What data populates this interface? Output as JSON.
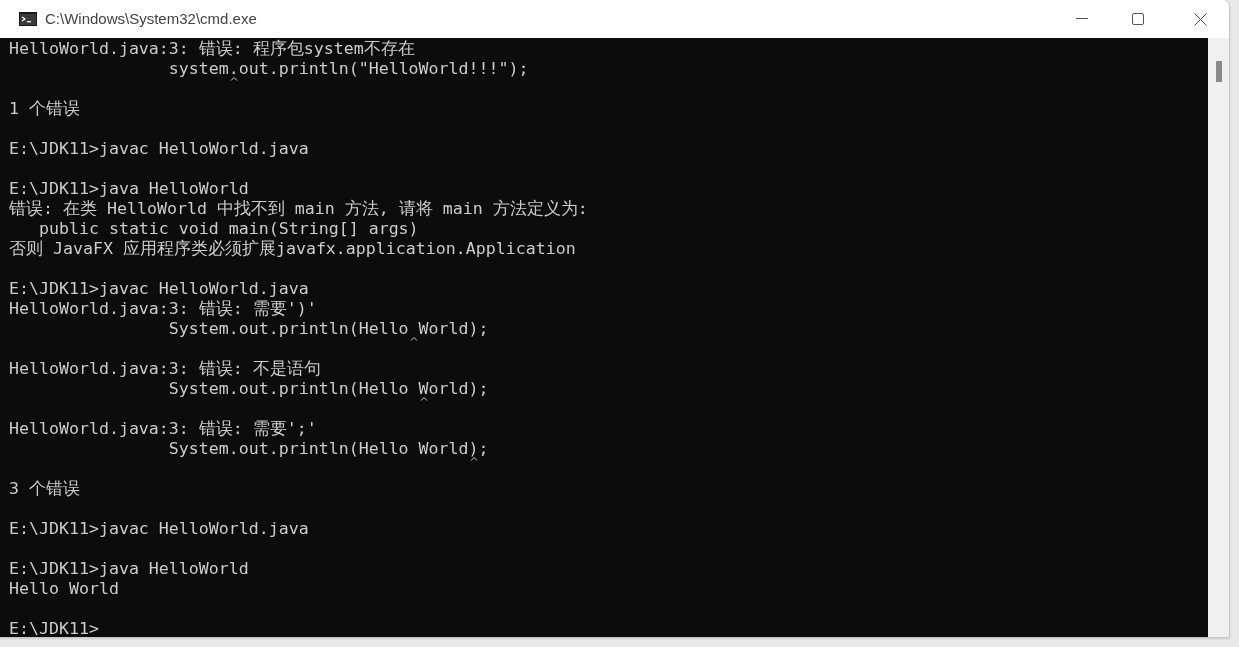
{
  "window": {
    "title": "C:\\Windows\\System32\\cmd.exe"
  },
  "console": {
    "lines": [
      {
        "kind": "text",
        "text": "HelloWorld.java:3: 错误: 程序包system不存在"
      },
      {
        "kind": "caret",
        "before": "                system",
        "after": ".out.println(\"HelloWorld!!!\");"
      },
      {
        "kind": "blank"
      },
      {
        "kind": "text",
        "text": "1 个错误"
      },
      {
        "kind": "blank"
      },
      {
        "kind": "text",
        "text": "E:\\JDK11>javac HelloWorld.java"
      },
      {
        "kind": "blank"
      },
      {
        "kind": "text",
        "text": "E:\\JDK11>java HelloWorld"
      },
      {
        "kind": "text",
        "text": "错误: 在类 HelloWorld 中找不到 main 方法, 请将 main 方法定义为:"
      },
      {
        "kind": "text",
        "text": "   public static void main(String[] args)"
      },
      {
        "kind": "text",
        "text": "否则 JavaFX 应用程序类必须扩展javafx.application.Application"
      },
      {
        "kind": "blank"
      },
      {
        "kind": "text",
        "text": "E:\\JDK11>javac HelloWorld.java"
      },
      {
        "kind": "text",
        "text": "HelloWorld.java:3: 错误: 需要')'"
      },
      {
        "kind": "caret",
        "before": "                System.out.println(Hello",
        "after": " World);"
      },
      {
        "kind": "blank"
      },
      {
        "kind": "text",
        "text": "HelloWorld.java:3: 错误: 不是语句"
      },
      {
        "kind": "caret",
        "before": "                System.out.println(Hello ",
        "after": "World);"
      },
      {
        "kind": "blank"
      },
      {
        "kind": "text",
        "text": "HelloWorld.java:3: 错误: 需要';'"
      },
      {
        "kind": "caret",
        "before": "                System.out.println(Hello World",
        "after": ");"
      },
      {
        "kind": "blank"
      },
      {
        "kind": "text",
        "text": "3 个错误"
      },
      {
        "kind": "blank"
      },
      {
        "kind": "text",
        "text": "E:\\JDK11>javac HelloWorld.java"
      },
      {
        "kind": "blank"
      },
      {
        "kind": "text",
        "text": "E:\\JDK11>java HelloWorld"
      },
      {
        "kind": "text",
        "text": "Hello World"
      },
      {
        "kind": "blank"
      },
      {
        "kind": "text",
        "text": "E:\\JDK11>"
      }
    ]
  }
}
